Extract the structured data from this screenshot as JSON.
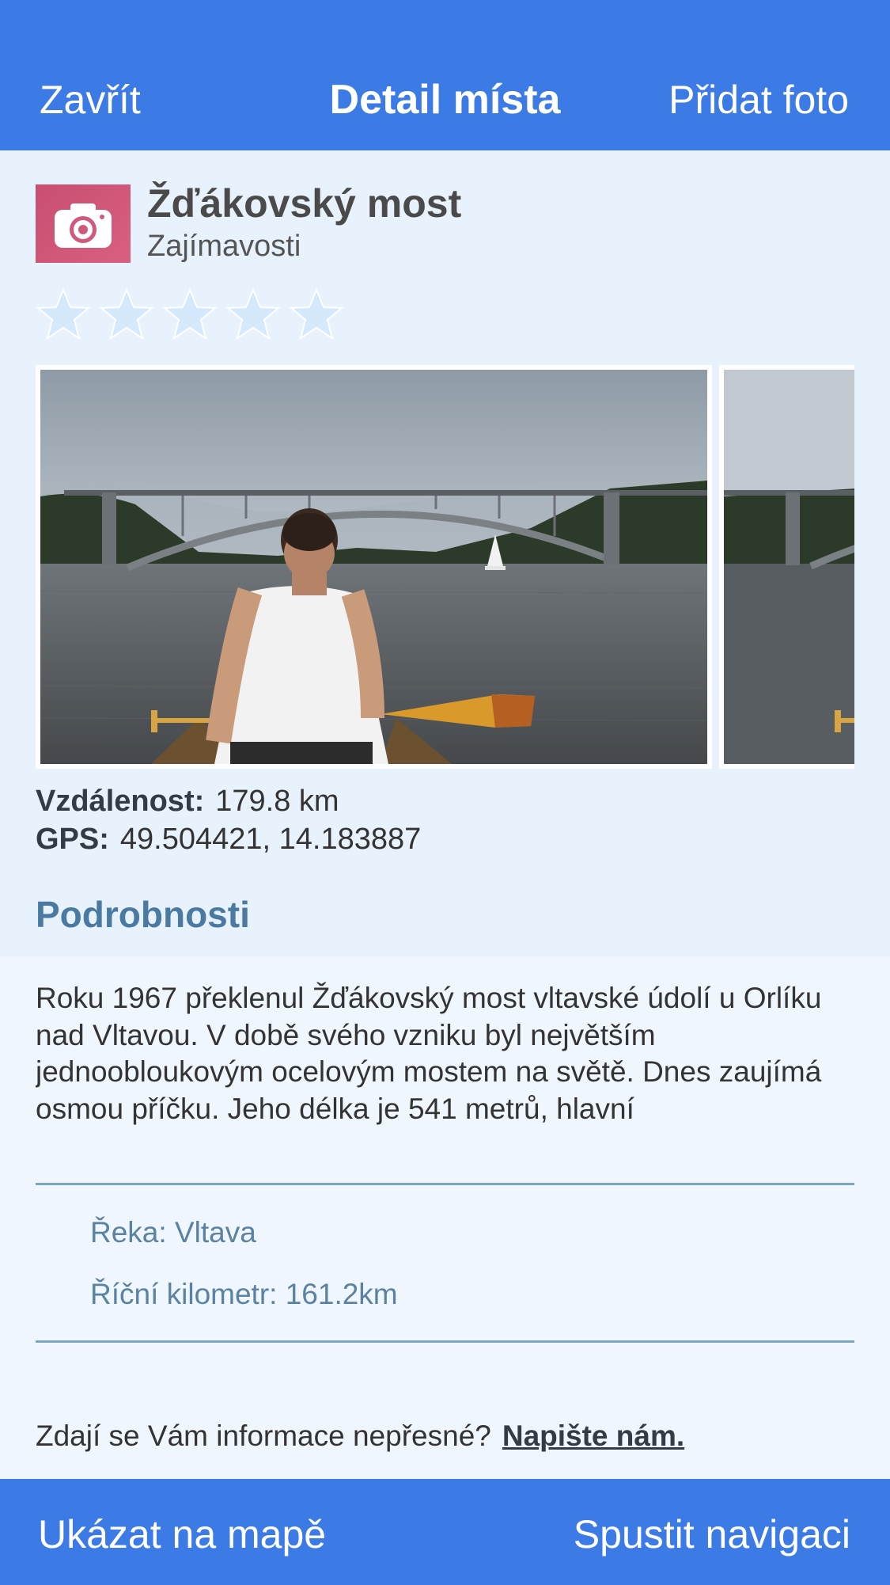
{
  "nav": {
    "close_label": "Zavřít",
    "title": "Detail místa",
    "add_photo_label": "Přidat foto"
  },
  "place": {
    "name": "Žďákovský most",
    "category": "Zajímavosti",
    "category_icon": "camera-icon",
    "rating": 0,
    "rating_max": 5
  },
  "stats": {
    "distance_label": "Vzdálenost:",
    "distance_value": "179.8 km",
    "gps_label": "GPS:",
    "gps_value": "49.504421, 14.183887"
  },
  "details": {
    "section_title": "Podrobnosti",
    "description": "Roku 1967 překlenul Žďákovský most vltavské údolí u Orlíku nad Vltavou. V době svého vzniku byl největším jednoobloukovým ocelovým mostem na světě. Dnes zaujímá osmou příčku. Jeho délka je 541 metrů, hlavní",
    "river": "Řeka: Vltava",
    "river_km": "Říční kilometr: 161.2km"
  },
  "feedback": {
    "question": "Zdají se Vám informace nepřesné?",
    "link": "Napište nám."
  },
  "bottom": {
    "show_on_map": "Ukázat na mapě",
    "start_navigation": "Spustit navigaci"
  },
  "colors": {
    "bar": "#3c7ae6",
    "background": "#e8f2fc",
    "accent_text": "#4a7aa1",
    "category_icon_bg": "#c94e72",
    "star_empty": "#d6e8fb"
  }
}
